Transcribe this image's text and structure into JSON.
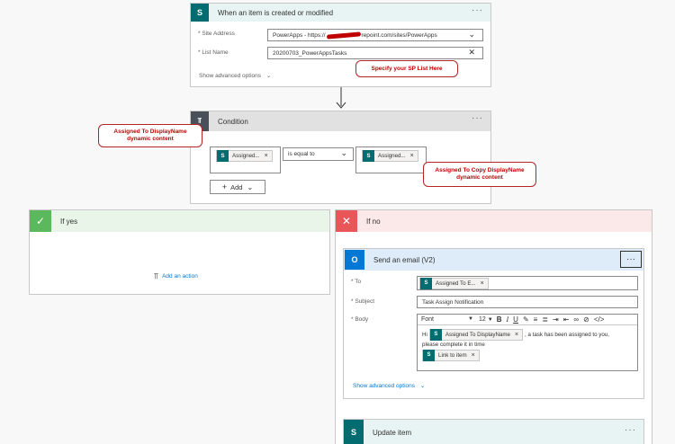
{
  "trigger": {
    "icon": "sharepoint-icon",
    "title": "When an item is created or modified",
    "more": "···",
    "site_label": "* Site Address",
    "site_value": "PowerApps - https://",
    "site_value_suffix": "repoint.com/sites/PowerApps",
    "list_label": "* List Name",
    "list_value": "20200703_PowerAppsTasks",
    "advanced": "Show advanced options"
  },
  "callouts": {
    "list": "Specify your SP List Here",
    "left_line1": "Assigned To DisplayName",
    "left_line2": "dynamic content",
    "right_line1": "Assigned To Copy DisplayName",
    "right_line2": "dynamic content"
  },
  "condition": {
    "title": "Condition",
    "more": "···",
    "left_token": "Assigned...",
    "operator": "is equal to",
    "right_token": "Assigned...",
    "add_label": "Add"
  },
  "if_yes": {
    "title": "If yes",
    "add_action": "Add an action"
  },
  "if_no": {
    "title": "If no"
  },
  "email": {
    "title": "Send an email (V2)",
    "more": "···",
    "to_label": "* To",
    "to_token": "Assigned To E...",
    "subject_label": "* Subject",
    "subject_value": "Task Assign Notification",
    "body_label": "* Body",
    "font": "Font",
    "font_size": "12",
    "body_hi": "Hi",
    "body_token": "Assigned To DisplayName",
    "body_text1": ", a task has been assigned to you,",
    "body_text2": "please complete it in time",
    "link_token": "Link to item",
    "advanced": "Show advanced options"
  },
  "update": {
    "title": "Update item",
    "more": "···"
  },
  "colors": {
    "sharepoint": "#036c70",
    "outlook": "#0078d4",
    "yes_green": "#5cb85c",
    "no_red": "#e8565a",
    "callout_red": "#c00000"
  }
}
